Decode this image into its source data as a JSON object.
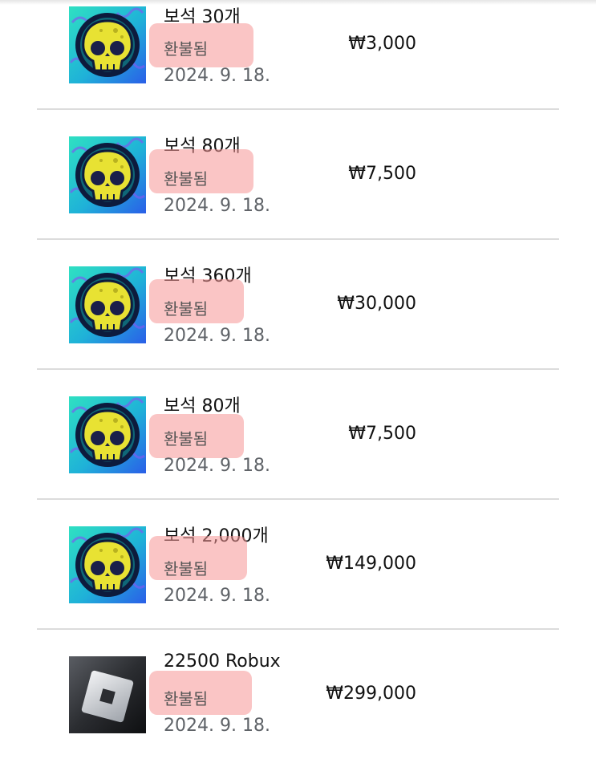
{
  "purchases": [
    {
      "title": "보석 30개",
      "status": "환불됨",
      "date": "2024. 9. 18.",
      "price": "₩3,000",
      "icon": "brawl-stars-skull-icon"
    },
    {
      "title": "보석 80개",
      "status": "환불됨",
      "date": "2024. 9. 18.",
      "price": "₩7,500",
      "icon": "brawl-stars-skull-icon"
    },
    {
      "title": "보석 360개",
      "status": "환불됨",
      "date": "2024. 9. 18.",
      "price": "₩30,000",
      "icon": "brawl-stars-skull-icon"
    },
    {
      "title": "보석 80개",
      "status": "환불됨",
      "date": "2024. 9. 18.",
      "price": "₩7,500",
      "icon": "brawl-stars-skull-icon"
    },
    {
      "title": "보석 2,000개",
      "status": "환불됨",
      "date": "2024. 9. 18.",
      "price": "₩149,000",
      "icon": "brawl-stars-skull-icon"
    },
    {
      "title": "22500 Robux",
      "status": "환불됨",
      "date": "2024. 9. 18.",
      "price": "₩299,000",
      "icon": "roblox-logo-icon"
    }
  ],
  "colors": {
    "highlight": "#f69696",
    "divider": "#dcdcdc",
    "date": "#5f6368",
    "skull": "#e8e233"
  }
}
